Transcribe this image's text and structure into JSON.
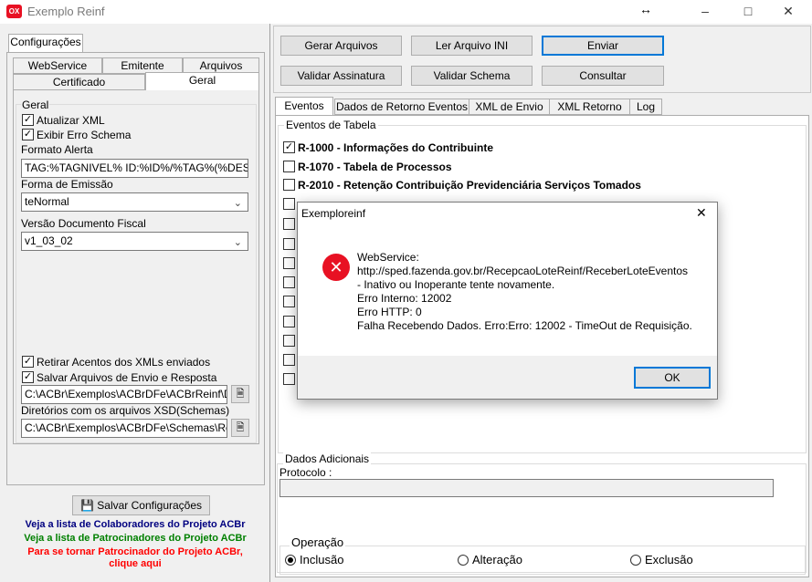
{
  "window": {
    "title": "Exemplo Reinf",
    "app_icon_text": "OX"
  },
  "left": {
    "main_tab": "Configurações",
    "tabs_row1": [
      "WebService",
      "Emitente",
      "Arquivos"
    ],
    "tabs_row2": [
      "Certificado",
      "Geral"
    ],
    "group_title": "Geral",
    "chk_atualizar": "Atualizar XML",
    "chk_exibir": "Exibir Erro Schema",
    "formato_label": "Formato Alerta",
    "formato_value": "TAG:%TAGNIVEL% ID:%ID%/%TAG%(%DESCRI",
    "forma_label": "Forma de Emissão",
    "forma_value": "teNormal",
    "versao_label": "Versão Documento Fiscal",
    "versao_value": "v1_03_02",
    "chk_retirar": "Retirar Acentos dos XMLs enviados",
    "chk_salvar": "Salvar Arquivos de Envio e Resposta",
    "path1": "C:\\ACBr\\Exemplos\\ACBrDFe\\ACBrReinf\\Delphi",
    "dir_label": "Diretórios com os arquivos XSD(Schemas)",
    "path2": "C:\\ACBr\\Exemplos\\ACBrDFe\\Schemas\\Reinf",
    "save_button": "Salvar Configurações",
    "link1": "Veja a lista de Colaboradores do Projeto ACBr",
    "link2": "Veja a lista de Patrocinadores do Projeto ACBr",
    "link3a": "Para se tornar Patrocinador do Projeto ACBr,",
    "link3b": "clique aqui",
    "colors": {
      "link1": "#000080",
      "link2": "#008000",
      "link3": "#ff0000"
    }
  },
  "toolbar": {
    "gerar": "Gerar Arquivos",
    "ler": "Ler Arquivo INI",
    "enviar": "Enviar",
    "validar_assinatura": "Validar Assinatura",
    "validar_schema": "Validar Schema",
    "consultar": "Consultar"
  },
  "right_tabs": [
    "Eventos",
    "Dados de Retorno Eventos",
    "XML de Envio",
    "XML Retorno",
    "Log"
  ],
  "eventos_group": "Eventos de Tabela",
  "events": [
    {
      "label": "R-1000 - Informações do Contribuinte",
      "checked": true
    },
    {
      "label": "R-1070 - Tabela de Processos",
      "checked": false
    },
    {
      "label": "R-2010 - Retenção Contribuição Previdenciária  Serviços Tomados",
      "checked": false
    }
  ],
  "dados_adicionais": {
    "title": "Dados Adicionais",
    "protocolo_label": "Protocolo :"
  },
  "operacao": {
    "title": "Operação",
    "inclusao": "Inclusão",
    "alteracao": "Alteração",
    "exclusao": "Exclusão"
  },
  "dialog": {
    "title": "Exemploreinf",
    "message": "WebService:\nhttp://sped.fazenda.gov.br/RecepcaoLoteReinf/ReceberLoteEventos\n- Inativo ou Inoperante tente novamente.\nErro Interno: 12002\nErro HTTP: 0\nFalha Recebendo Dados. Erro:Erro: 12002 - TimeOut de Requisição.",
    "ok": "OK"
  }
}
